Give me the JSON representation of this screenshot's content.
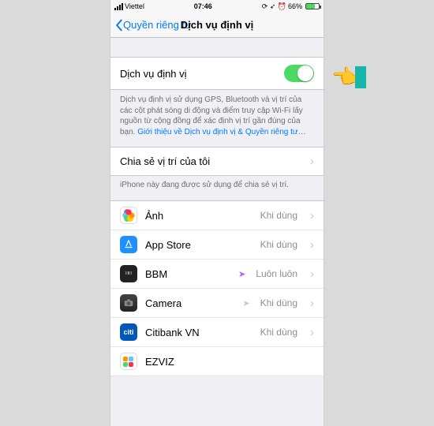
{
  "statusbar": {
    "carrier": "Viettel",
    "time": "07:46",
    "battery_pct": "66%"
  },
  "navbar": {
    "back_label": "Quyền riêng tư",
    "title": "Dịch vụ định vị"
  },
  "main_toggle": {
    "label": "Dịch vụ định vị",
    "on": true
  },
  "description": {
    "text": "Dịch vụ định vị sử dụng GPS, Bluetooth và vị trí của các cột phát sóng di động và điểm truy cập Wi-Fi lấy nguồn từ cộng đồng để xác định vị trí gần đúng của bạn. ",
    "link": "Giới thiệu về Dịch vụ định vị & Quyền riêng tư…"
  },
  "share_cell": {
    "label": "Chia sẻ vị trí của tôi"
  },
  "share_footnote": "iPhone này đang được sử dụng để chia sẻ vị trí.",
  "status_labels": {
    "while_using": "Khi dùng",
    "always": "Luôn luôn"
  },
  "apps": [
    {
      "name": "Ảnh",
      "status": "while_using",
      "indicator": "none",
      "icon": "photos"
    },
    {
      "name": "App Store",
      "status": "while_using",
      "indicator": "none",
      "icon": "appstore"
    },
    {
      "name": "BBM",
      "status": "always",
      "indicator": "active",
      "icon": "bbm"
    },
    {
      "name": "Camera",
      "status": "while_using",
      "indicator": "outline",
      "icon": "camera"
    },
    {
      "name": "Citibank VN",
      "status": "while_using",
      "indicator": "none",
      "icon": "citi"
    },
    {
      "name": "EZVIZ",
      "status": "",
      "indicator": "none",
      "icon": "ezviz"
    }
  ]
}
